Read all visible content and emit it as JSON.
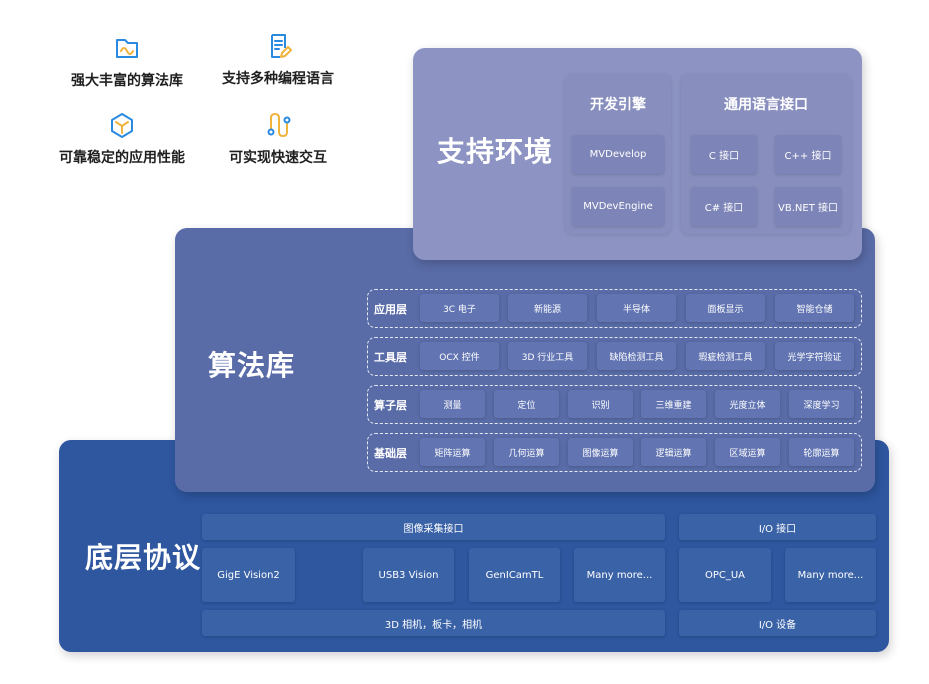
{
  "features": [
    {
      "icon": "folder-wave-icon",
      "label": "强大丰富的算法库"
    },
    {
      "icon": "document-edit-icon",
      "label": "支持多种编程语言"
    },
    {
      "icon": "cube-icon",
      "label": "可靠稳定的应用性能"
    },
    {
      "icon": "path-connect-icon",
      "label": "可实现快速交互"
    }
  ],
  "support_env": {
    "title": "支持环境",
    "dev_engine": {
      "title": "开发引擎",
      "items": [
        "MVDevelop",
        "MVDevEngine"
      ]
    },
    "lang_interface": {
      "title": "通用语言接口",
      "items": [
        "C 接口",
        "C++ 接口",
        "C# 接口",
        "VB.NET 接口"
      ]
    }
  },
  "algo_lib": {
    "title": "算法库",
    "layers": [
      {
        "label": "应用层",
        "items": [
          "3C 电子",
          "新能源",
          "半导体",
          "面板显示",
          "智能仓储"
        ]
      },
      {
        "label": "工具层",
        "items": [
          "OCX 控件",
          "3D 行业工具",
          "缺陷检测工具",
          "瑕疵检测工具",
          "光学字符验证"
        ]
      },
      {
        "label": "算子层",
        "items": [
          "测量",
          "定位",
          "识别",
          "三维重建",
          "光度立体",
          "深度学习"
        ]
      },
      {
        "label": "基础层",
        "items": [
          "矩阵运算",
          "几何运算",
          "图像运算",
          "逻辑运算",
          "区域运算",
          "轮廓运算"
        ]
      }
    ]
  },
  "protocol": {
    "title": "底层协议",
    "image_acq": {
      "header": "图像采集接口",
      "items": [
        "GigE Vision2",
        "USB3 Vision",
        "GenICamTL",
        "Many more..."
      ],
      "footer": "3D 相机，板卡，相机"
    },
    "io": {
      "header": "I/O 接口",
      "items": [
        "OPC_UA",
        "Many more..."
      ],
      "footer": "I/O 设备"
    }
  },
  "colors": {
    "icon_blue": "#2a8ae0",
    "icon_orange": "#f0b43c",
    "support_panel": "#8d94c3",
    "algo_panel": "#5a6ca8",
    "protocol_panel": "#2e57a0"
  }
}
